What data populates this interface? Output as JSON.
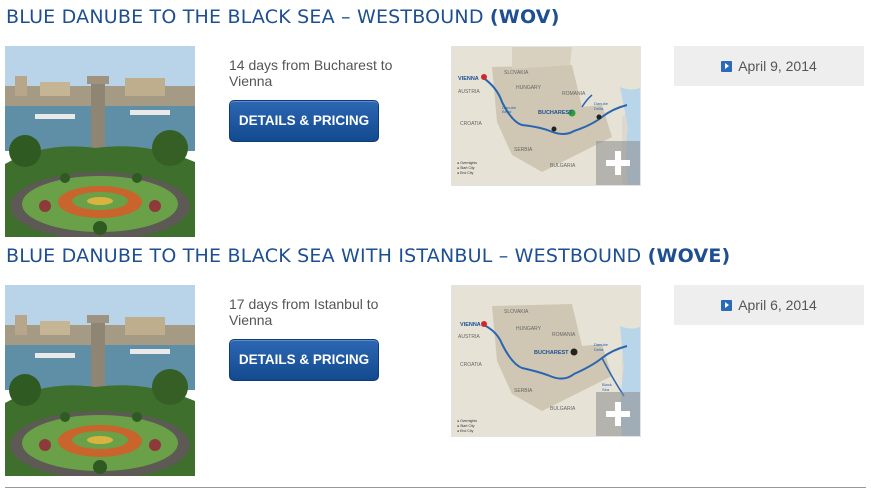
{
  "cruises": [
    {
      "title": "BLUE DANUBE TO THE BLACK SEA – WESTBOUND",
      "code": "(WOV)",
      "description": "14 days from Bucharest to Vienna",
      "button_label": "DETAILS & PRICING",
      "date": "April 9, 2014",
      "map": {
        "countries": [
          "SLOVAKIA",
          "AUSTRIA",
          "HUNGARY",
          "ROMANIA",
          "CROATIA",
          "SERBIA",
          "BULGARIA"
        ],
        "cities": [
          "VIENNA",
          "BUCHAREST",
          "BRATISLAVA",
          "BUDAPEST",
          "PETESTI",
          "TULCEA",
          "MOHACS",
          "OSIJEK",
          "VUKOVAR",
          "BELGRADE",
          "IRON GATES",
          "GIURGIU",
          "RUSSE",
          "VELIKO TARNOVO",
          "ARBANASI",
          "CERNAVODA",
          "CONSTANTA",
          "SVISTOV",
          "KALOCSA"
        ],
        "labels": [
          "Danube Bend",
          "Danube Delta",
          "OLT. GHEORGHE",
          "Sava River"
        ],
        "legend": [
          "Overnights",
          "Start City",
          "End City"
        ]
      }
    },
    {
      "title": "BLUE DANUBE TO THE BLACK SEA WITH ISTANBUL – WESTBOUND",
      "code": "(WOVE)",
      "description": "17 days from Istanbul to Vienna",
      "button_label": "DETAILS & PRICING",
      "date": "April 6, 2014",
      "map": {
        "countries": [
          "SLOVAKIA",
          "AUSTRIA",
          "HUNGARY",
          "ROMANIA",
          "CROATIA",
          "SERBIA",
          "BULGARIA"
        ],
        "cities": [
          "VIENNA",
          "BUCHAREST",
          "BRATISLAVA",
          "BUDAPEST",
          "TULCEA",
          "MOHACS",
          "OSIJEK",
          "VUKOVAR",
          "BELGRADE",
          "IRON GATES",
          "GIURGIU",
          "RUSSE",
          "VELIKO TARNOVO",
          "ARBANASI",
          "CERNAVODA",
          "CONSTANTA",
          "SVISTOV",
          "KALOCSA"
        ],
        "labels": [
          "Danube Bend",
          "Danube Delta",
          "OLT. GHEORGHE",
          "Sava River",
          "Black Sea",
          "Transylvania"
        ],
        "legend": [
          "Overnights",
          "Start City",
          "End City"
        ]
      }
    }
  ],
  "colors": {
    "title": "#1d4f91",
    "button_top": "#2d67b3",
    "button_bottom": "#134a8f",
    "date_bg": "#eeeeee",
    "play_icon": "#2a6ab8"
  },
  "icons": {
    "date": "play-icon",
    "map": "plus-icon"
  }
}
